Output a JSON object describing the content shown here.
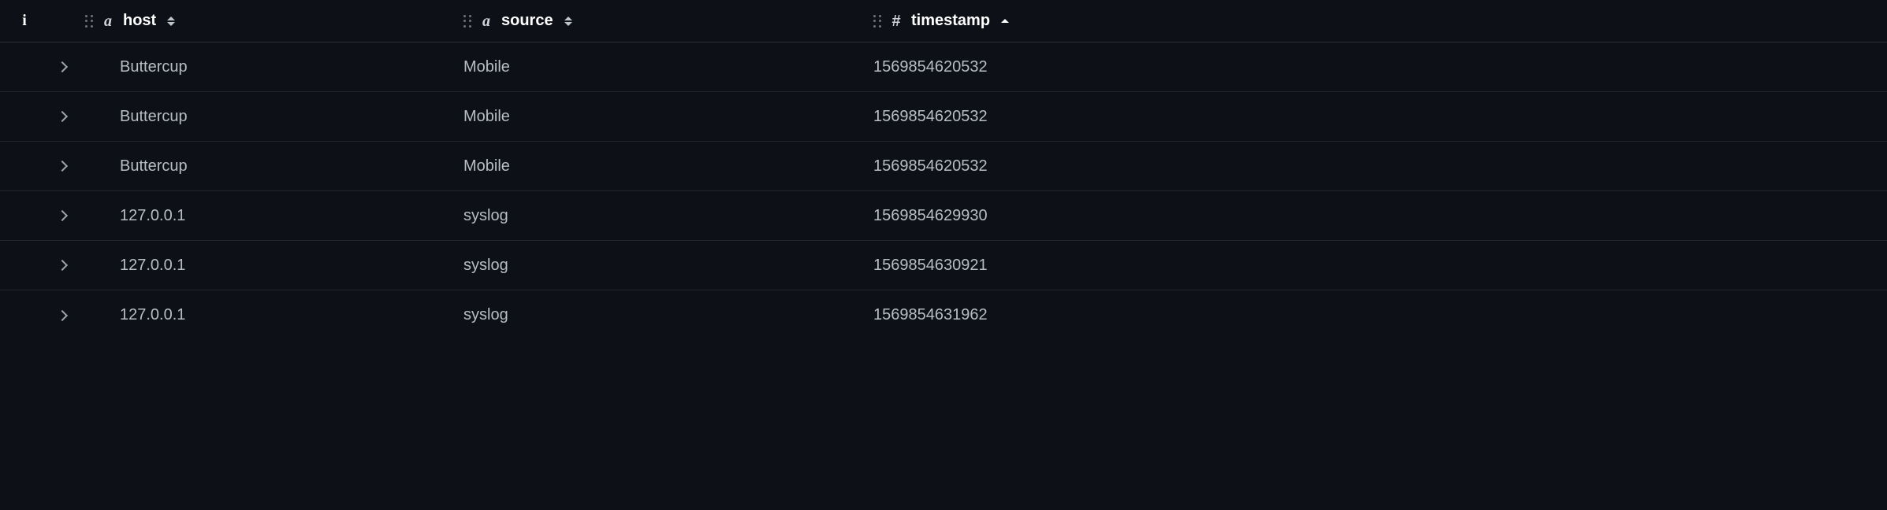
{
  "columns": {
    "info": {
      "label": "i"
    },
    "host": {
      "label": "host",
      "type": "string",
      "sort": "both"
    },
    "source": {
      "label": "source",
      "type": "string",
      "sort": "both"
    },
    "timestamp": {
      "label": "timestamp",
      "type": "number",
      "sort": "asc"
    }
  },
  "rows": [
    {
      "host": "Buttercup",
      "source": "Mobile",
      "timestamp": "1569854620532"
    },
    {
      "host": "Buttercup",
      "source": "Mobile",
      "timestamp": "1569854620532"
    },
    {
      "host": "Buttercup",
      "source": "Mobile",
      "timestamp": "1569854620532"
    },
    {
      "host": "127.0.0.1",
      "source": "syslog",
      "timestamp": "1569854629930"
    },
    {
      "host": "127.0.0.1",
      "source": "syslog",
      "timestamp": "1569854630921"
    },
    {
      "host": "127.0.0.1",
      "source": "syslog",
      "timestamp": "1569854631962"
    }
  ]
}
